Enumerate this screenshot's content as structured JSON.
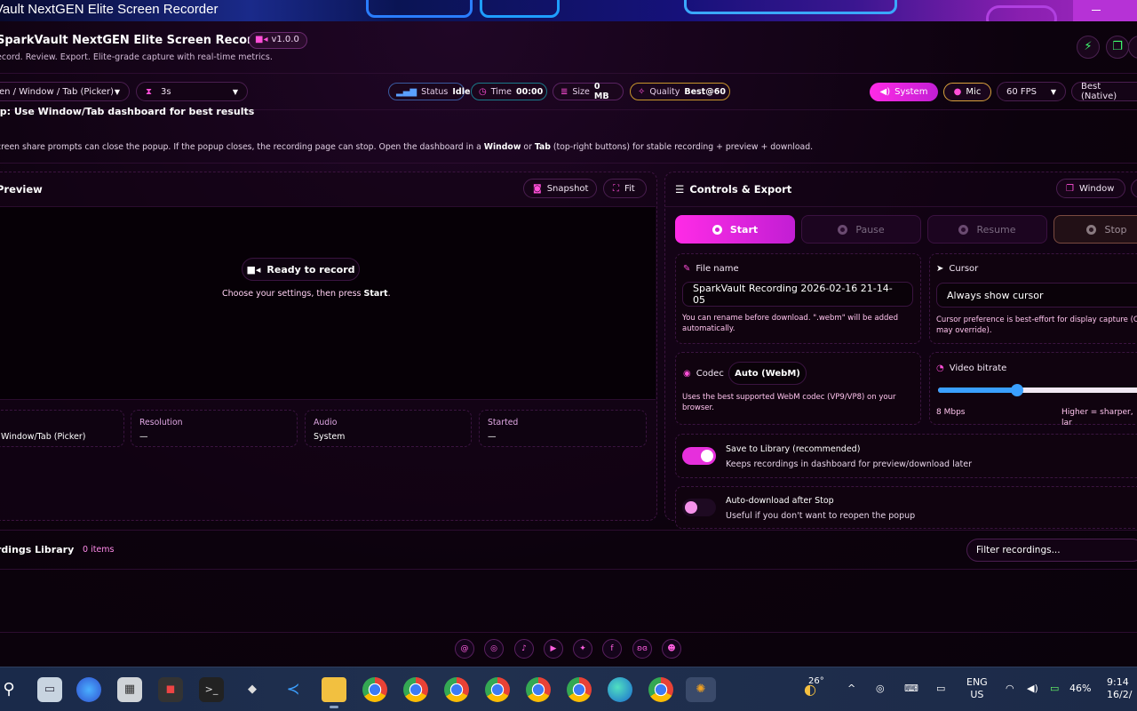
{
  "window": {
    "title": "Vault NextGEN Elite Screen Recorder"
  },
  "header": {
    "app_name": "SparkVault NextGEN Elite Screen Recorder",
    "version": "v1.0.0",
    "subtitle": "ecord. Review. Export. Elite-grade capture with real-time metrics."
  },
  "toolbar": {
    "source_select": "en / Window / Tab (Picker)",
    "countdown_select": "3s",
    "status": {
      "label": "Status",
      "value": "Idle"
    },
    "time": {
      "label": "Time",
      "value": "00:00"
    },
    "size": {
      "label": "Size",
      "value": "0 MB"
    },
    "quality": {
      "label": "Quality",
      "value": "Best@60"
    },
    "system_audio": "System",
    "mic": "Mic",
    "fps_select": "60 FPS",
    "resolution_select": "Best (Native)"
  },
  "tip": {
    "title": "ip: Use Window/Tab dashboard for best results",
    "text_1": "creen share prompts can close the popup. If the popup closes, the recording page can stop. Open the dashboard in a ",
    "b1": "Window",
    "text_2": " or ",
    "b2": "Tab",
    "text_3": " (top-right buttons) for stable recording + preview + download."
  },
  "preview": {
    "title": "Preview",
    "snapshot": "Snapshot",
    "fit": "Fit",
    "ready": "Ready to record",
    "ready_sub_1": "Choose your settings, then press ",
    "ready_sub_b": "Start",
    "ready_sub_2": ".",
    "stats": [
      {
        "label": "",
        "value": "Window/Tab (Picker)"
      },
      {
        "label": "Resolution",
        "value": "—"
      },
      {
        "label": "Audio",
        "value": "System"
      },
      {
        "label": "Started",
        "value": "—"
      }
    ]
  },
  "controls": {
    "title": "Controls & Export",
    "window_btn": "Window",
    "start": "Start",
    "pause": "Pause",
    "resume": "Resume",
    "stop": "Stop",
    "file_name_label": "File name",
    "file_name_value": "SparkVault Recording 2026-02-16 21-14-05",
    "file_name_hint": "You can rename before download. \".webm\" will be added automatically.",
    "cursor_label": "Cursor",
    "cursor_value": "Always show cursor",
    "cursor_hint": "Cursor preference is best-effort for display capture (Ch may override).",
    "codec_label": "Codec",
    "codec_value": "Auto (WebM)",
    "codec_hint": "Uses the best supported WebM codec (VP9/VP8) on your browser.",
    "bitrate_label": "Video bitrate",
    "bitrate_value": "8 Mbps",
    "bitrate_hint": "Higher = sharper, lar",
    "bitrate_fraction": 0.37,
    "save_library_title": "Save to Library (recommended)",
    "save_library_sub": "Keeps recordings in dashboard for preview/download later",
    "save_library_on": true,
    "auto_download_title": "Auto-download after Stop",
    "auto_download_sub": "Useful if you don't want to reopen the popup",
    "auto_download_on": false
  },
  "library": {
    "title": "rdings Library",
    "count": "0 items",
    "filter_placeholder": "Filter recordings..."
  },
  "taskbar": {
    "weather_temp": "26°",
    "lang_1": "ENG",
    "lang_2": "US",
    "battery": "46%",
    "time": "9:14",
    "date": "16/2/"
  }
}
